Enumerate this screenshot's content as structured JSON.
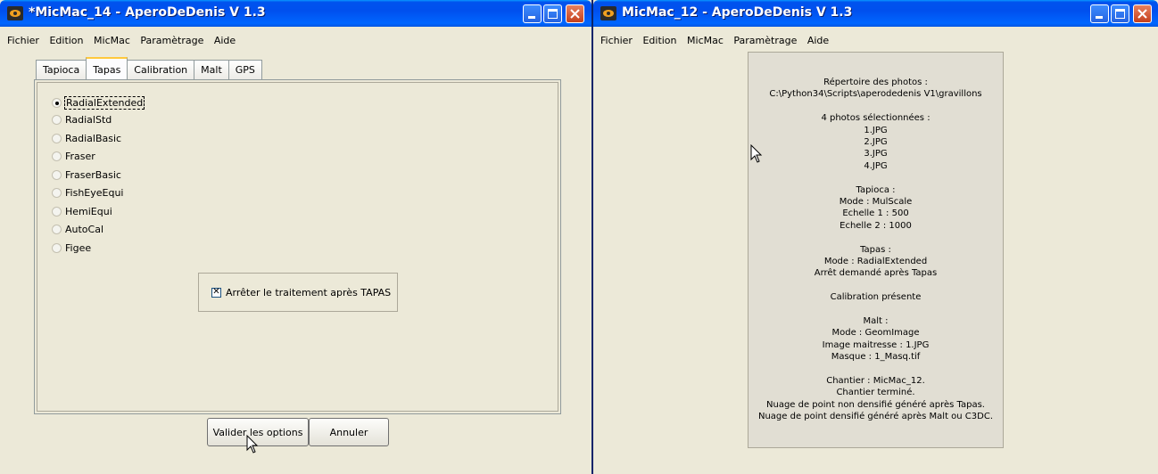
{
  "left_window": {
    "title": "*MicMac_14 - AperoDeDenis V 1.3",
    "menu": [
      "Fichier",
      "Edition",
      "MicMac",
      "Paramètrage",
      "Aide"
    ],
    "tabs": [
      "Tapioca",
      "Tapas",
      "Calibration",
      "Malt",
      "GPS"
    ],
    "active_tab": "Tapas",
    "radio_options": [
      "RadialExtended",
      "RadialStd",
      "RadialBasic",
      "Fraser",
      "FraserBasic",
      "FishEyeEqui",
      "HemiEqui",
      "AutoCal",
      "Figee"
    ],
    "selected_option": "RadialExtended",
    "checkbox_label": "Arrêter le traitement après TAPAS",
    "checkbox_checked": true,
    "validate_label": "Valider les options",
    "cancel_label": "Annuler"
  },
  "right_window": {
    "title": "MicMac_12 - AperoDeDenis V 1.3",
    "menu": [
      "Fichier",
      "Edition",
      "MicMac",
      "Paramètrage",
      "Aide"
    ],
    "summary_lines": [
      "Répertoire des photos :",
      "C:\\Python34\\Scripts\\aperodedenis V1\\gravillons",
      "",
      "4 photos sélectionnées :",
      "1.JPG",
      "2.JPG",
      "3.JPG",
      "4.JPG",
      "",
      "Tapioca :",
      "Mode : MulScale",
      "Echelle 1 : 500",
      "Echelle 2 : 1000",
      "",
      "Tapas :",
      "Mode : RadialExtended",
      "Arrêt demandé après Tapas",
      "",
      "Calibration présente",
      "",
      "Malt :",
      "Mode : GeomImage",
      "Image maitresse : 1.JPG",
      "Masque : 1_Masq.tif",
      "",
      "Chantier : MicMac_12.",
      "Chantier terminé.",
      "Nuage de point non densifié généré après Tapas.",
      "Nuage de point densifié généré après Malt ou C3DC."
    ]
  },
  "colors": {
    "titlebar": "#0053ee",
    "window_bg": "#ece9d8",
    "summary_bg": "#e1ded3"
  }
}
